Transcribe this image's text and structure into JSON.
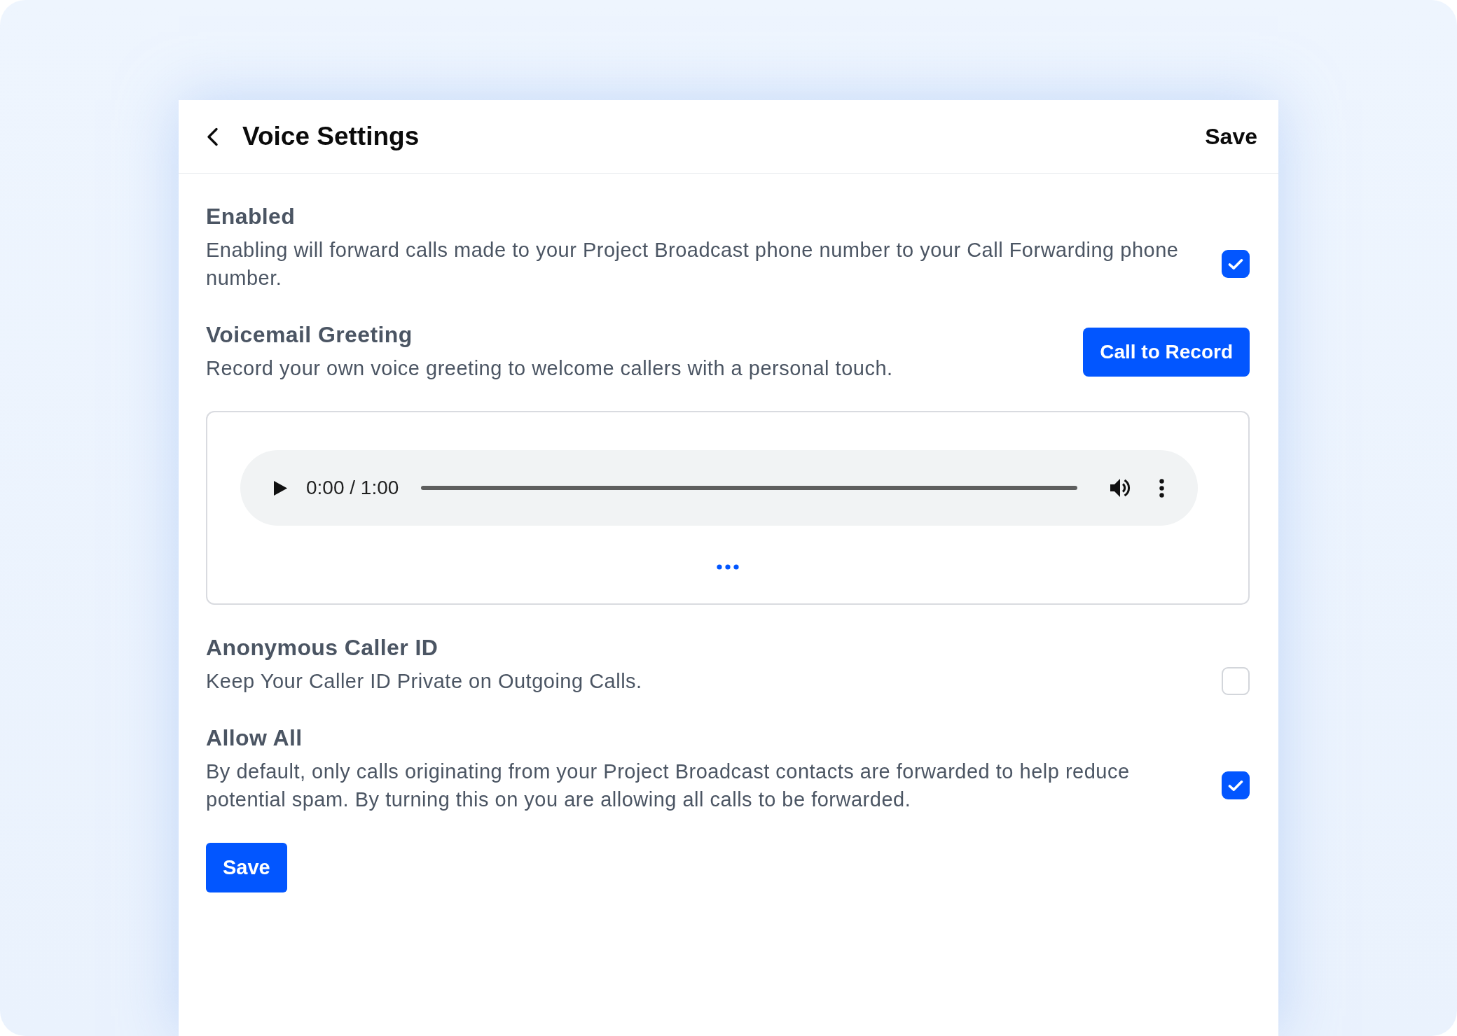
{
  "header": {
    "title": "Voice Settings",
    "action": "Save"
  },
  "settings": [
    {
      "kind": "checkbox",
      "title": "Enabled",
      "description": "Enabling will forward calls made to your Project Broadcast phone number to your Call Forwarding phone number.",
      "checked": true
    },
    {
      "kind": "recording",
      "title": "Voicemail Greeting",
      "description": "Record your own voice greeting to welcome callers with a personal touch.",
      "button": "Call to Record",
      "player": {
        "time": "0:00 / 1:00"
      }
    },
    {
      "kind": "checkbox",
      "title": "Anonymous Caller ID",
      "description": "Keep Your Caller ID Private on Outgoing Calls.",
      "checked": false
    },
    {
      "kind": "checkbox",
      "title": "Allow All",
      "description": "By default, only calls originating from your Project Broadcast contacts are forwarded to help reduce potential spam. By turning this on you are allowing all calls to be forwarded.",
      "checked": true
    }
  ],
  "save_button": "Save"
}
